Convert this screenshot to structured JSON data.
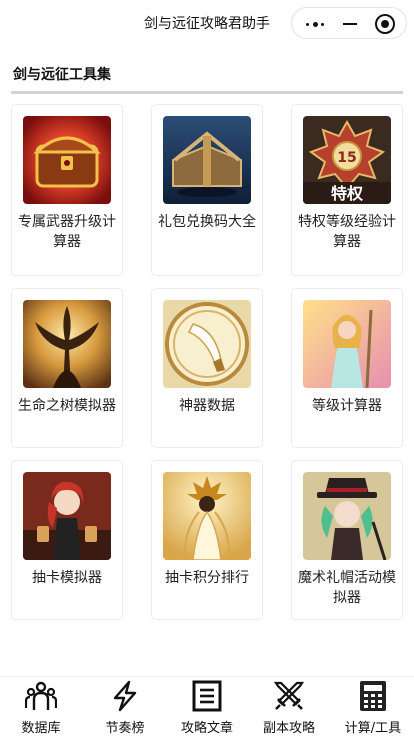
{
  "header": {
    "title": "剑与远征攻略君助手",
    "capsule": {
      "more_icon": "more-dots-icon",
      "minimize_icon": "minimize-icon",
      "close_icon": "target-close-icon"
    }
  },
  "section": {
    "title": "剑与远征工具集"
  },
  "tools": [
    {
      "label": "专属武器升级计算器",
      "icon": "treasure-chest-icon"
    },
    {
      "label": "礼包兑换码大全",
      "icon": "gift-chest-icon"
    },
    {
      "label": "特权等级经验计算器",
      "icon": "privilege-badge-icon",
      "badge_number": "15",
      "badge_text": "特权"
    },
    {
      "label": "生命之树模拟器",
      "icon": "tree-of-life-icon"
    },
    {
      "label": "神器数据",
      "icon": "artifact-icon"
    },
    {
      "label": "等级计算器",
      "icon": "level-hero-icon"
    },
    {
      "label": "抽卡模拟器",
      "icon": "summon-hero-icon"
    },
    {
      "label": "抽卡积分排行",
      "icon": "summon-ranking-icon"
    },
    {
      "label": "魔术礼帽活动模拟器",
      "icon": "magic-hat-icon"
    }
  ],
  "tabbar": [
    {
      "label": "数据库",
      "icon": "people-icon"
    },
    {
      "label": "节奏榜",
      "icon": "lightning-icon"
    },
    {
      "label": "攻略文章",
      "icon": "article-icon"
    },
    {
      "label": "副本攻略",
      "icon": "crossed-swords-icon"
    },
    {
      "label": "计算/工具",
      "icon": "calculator-icon"
    }
  ],
  "colors": {
    "accent": "#111111",
    "divider": "#d3d3d3",
    "card_border": "#ececec"
  }
}
